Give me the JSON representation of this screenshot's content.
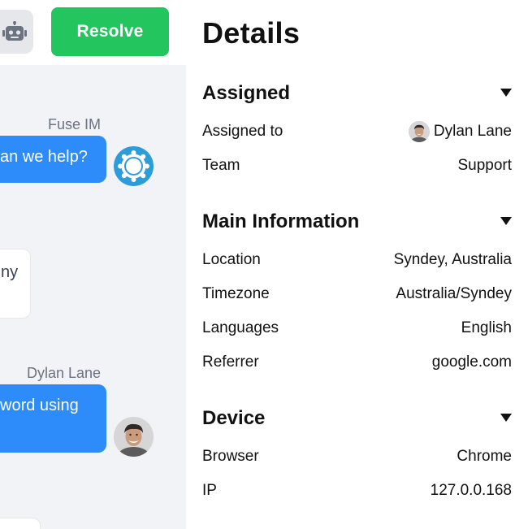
{
  "toolbar": {
    "bot_icon": "robot-icon",
    "resolve_label": "Resolve",
    "resolve_color": "#22c55e"
  },
  "chat": {
    "messages": [
      {
        "direction": "outgoing",
        "sender": "Fuse IM",
        "text": "an we help?",
        "avatar": "gear-logo-icon"
      },
      {
        "direction": "incoming",
        "text": "ny"
      },
      {
        "direction": "outgoing",
        "sender": "Dylan Lane",
        "text": "word using",
        "avatar": "user-photo"
      },
      {
        "direction": "incoming",
        "text": ""
      }
    ],
    "bubble_color": "#2d8cfa",
    "background": "#f1f3f6"
  },
  "details": {
    "title": "Details",
    "sections": [
      {
        "title": "Assigned",
        "rows": [
          {
            "label": "Assigned to",
            "value": "Dylan Lane",
            "has_avatar": true
          },
          {
            "label": "Team",
            "value": "Support"
          }
        ]
      },
      {
        "title": "Main Information",
        "rows": [
          {
            "label": "Location",
            "value": "Syndey, Australia"
          },
          {
            "label": "Timezone",
            "value": "Australia/Syndey"
          },
          {
            "label": "Languages",
            "value": "English"
          },
          {
            "label": "Referrer",
            "value": "google.com"
          }
        ]
      },
      {
        "title": "Device",
        "rows": [
          {
            "label": "Browser",
            "value": "Chrome"
          },
          {
            "label": "IP",
            "value": "127.0.0.168"
          }
        ]
      }
    ]
  }
}
